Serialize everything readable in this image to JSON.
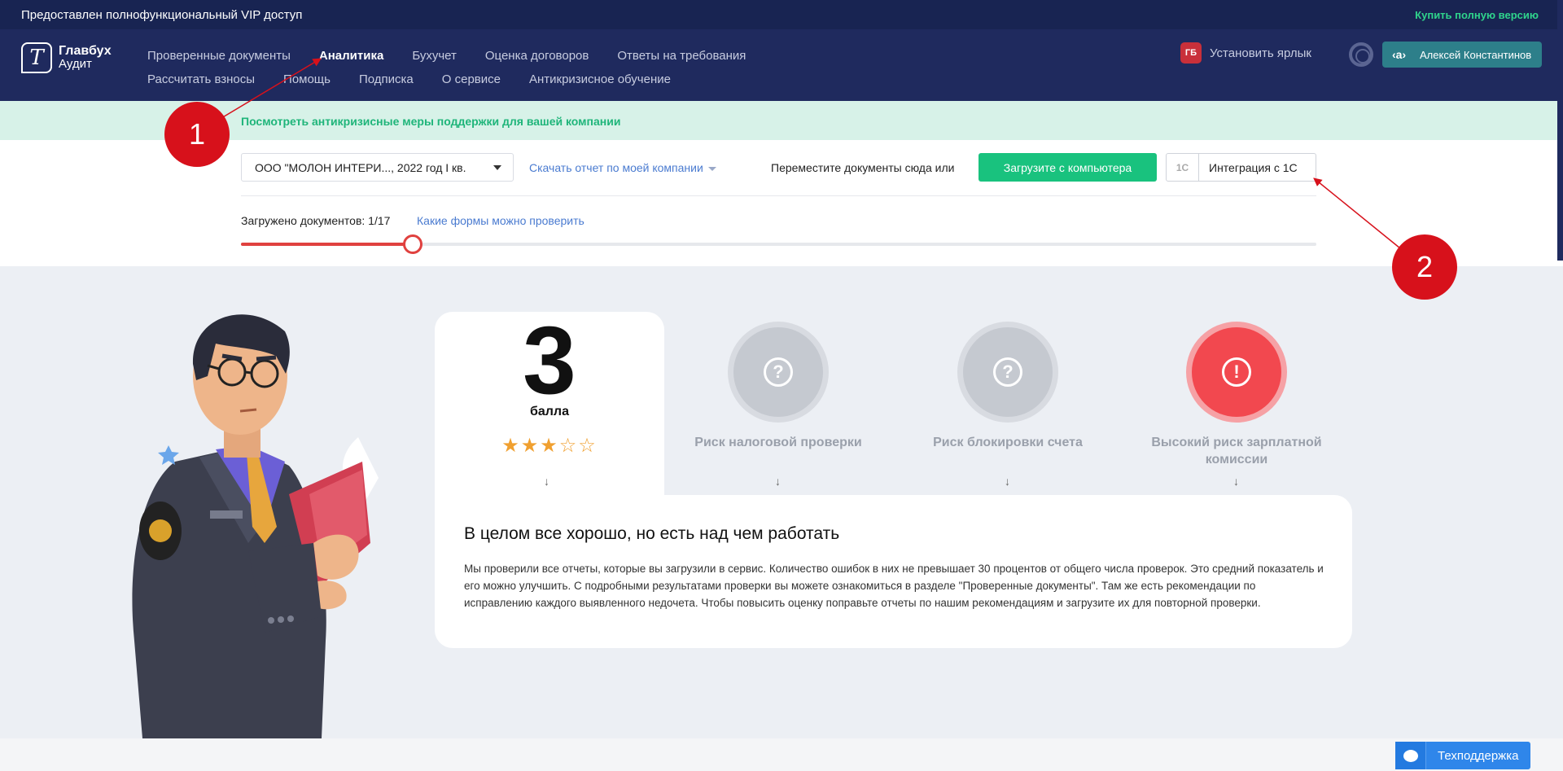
{
  "topbar": {
    "vip_text": "Предоставлен полнофункциональный VIP доступ",
    "buy_link": "Купить полную версию"
  },
  "header": {
    "logo": {
      "line1": "Главбух",
      "line2": "Аудит",
      "icon": "glavbukh-logo-icon"
    },
    "nav_row1": [
      {
        "label": "Проверенные документы",
        "active": false
      },
      {
        "label": "Аналитика",
        "active": true
      },
      {
        "label": "Бухучет",
        "active": false
      },
      {
        "label": "Оценка договоров",
        "active": false
      },
      {
        "label": "Ответы на требования",
        "active": false
      }
    ],
    "nav_row2": [
      {
        "label": "Рассчитать взносы"
      },
      {
        "label": "Помощь"
      },
      {
        "label": "Подписка"
      },
      {
        "label": "О сервисе"
      },
      {
        "label": "Антикризисное обучение"
      }
    ],
    "shortcut_label": "Установить ярлык",
    "shortcut_icon_text": "ГБ",
    "user_icon_text": "‹a›",
    "user_name": "Алексей Константинов"
  },
  "promo": {
    "text": "Посмотреть антикризисные меры поддержки для вашей компании"
  },
  "upload": {
    "company_select": "ООО \"МОЛОН ИНТЕРИ...,  2022 год I кв.",
    "download_link": "Скачать отчет по моей компании",
    "move_text": "Переместите документы сюда или",
    "upload_button": "Загрузите с компьютера",
    "integration_icon": "1С",
    "integration_button": "Интеграция с 1С",
    "loaded_text": "Загружено документов: 1/17",
    "forms_link": "Какие формы можно проверить",
    "progress_fraction": 0.16
  },
  "score": {
    "value": "3",
    "unit": "балла",
    "stars": "★★★☆☆",
    "rating": 3,
    "rating_max": 5
  },
  "risks": [
    {
      "label": "Риск налоговой проверки",
      "level": "unknown",
      "glyph": "?"
    },
    {
      "label": "Риск блокировки счета",
      "level": "unknown",
      "glyph": "?"
    },
    {
      "label": "Высокий риск зарплатной комиссии",
      "level": "high",
      "glyph": "!"
    }
  ],
  "arrow_glyph": "↓",
  "summary": {
    "title": "В целом все хорошо, но есть над чем работать",
    "text": "Мы проверили все отчеты, которые вы загрузили в сервис. Количество ошибок в них не превышает 30 процентов от общего числа проверок. Это средний показатель и его можно улучшить. С подробными результатами проверки вы можете ознакомиться в разделе \"Проверенные документы\". Там же есть рекомендации по исправлению каждого выявленного недочета. Чтобы повысить оценку поправьте отчеты по нашим рекомендациям и загрузите их для повторной проверки."
  },
  "support": {
    "label": "Техподдержка"
  },
  "annotations": [
    {
      "number": "1"
    },
    {
      "number": "2"
    }
  ],
  "colors": {
    "header_bg": "#1f2a5e",
    "accent_green": "#19c27e",
    "progress_red": "#e0413f",
    "risk_red": "#f2484f",
    "link_blue": "#4a7bd0",
    "badge_red": "#d7111b"
  }
}
